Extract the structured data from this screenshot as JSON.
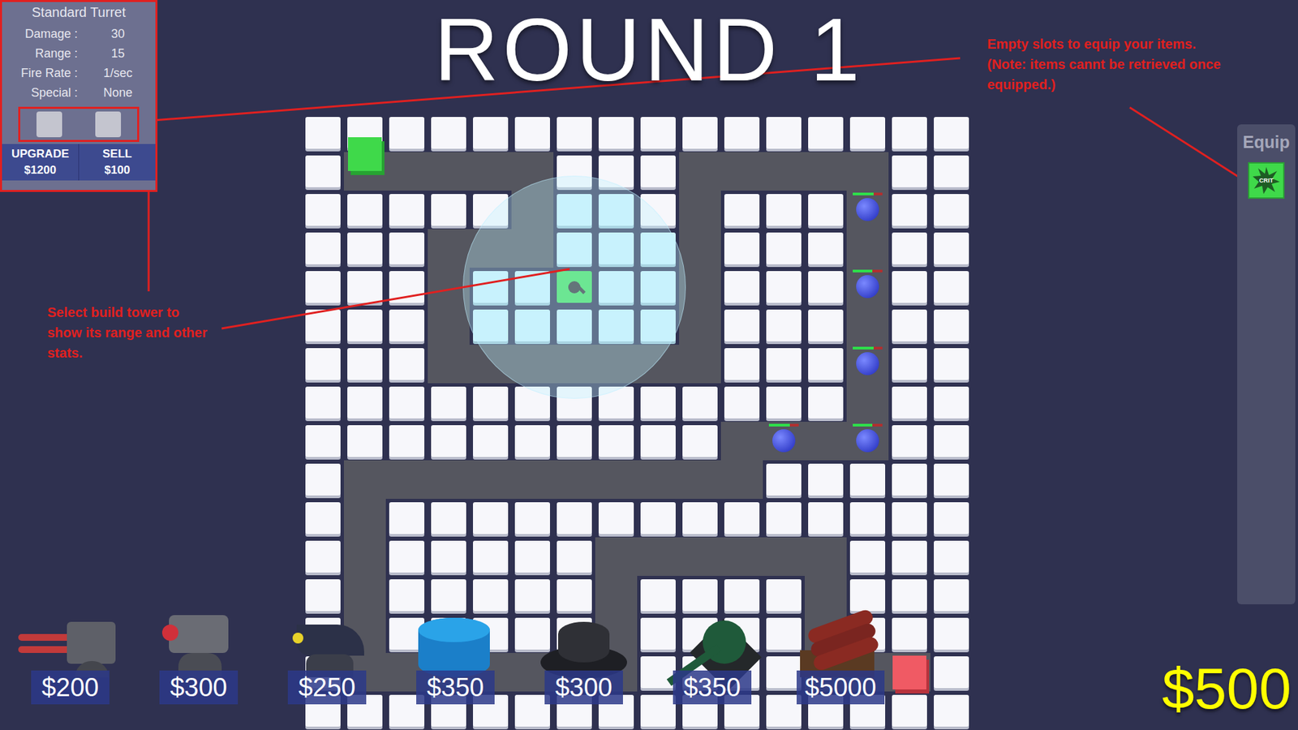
{
  "title": "ROUND 1",
  "tower_panel": {
    "name": "Standard Turret",
    "stats": [
      {
        "label": "Damage :",
        "value": "30"
      },
      {
        "label": "Range :",
        "value": "15"
      },
      {
        "label": "Fire Rate :",
        "value": "1/sec"
      },
      {
        "label": "Special :",
        "value": "None"
      }
    ],
    "slots": [
      {
        "filled": false
      },
      {
        "filled": false
      }
    ],
    "buttons": [
      {
        "label": "UPGRADE",
        "price": "$1200"
      },
      {
        "label": "SELL",
        "price": "$100"
      }
    ]
  },
  "annotations": [
    {
      "text": "Empty slots to equip your items. (Note: items cannt be retrieved once equipped.)"
    },
    {
      "text": "Select build tower to show its range and other stats."
    }
  ],
  "equip": {
    "title": "Equip",
    "items": [
      {
        "label": "CRIT"
      }
    ]
  },
  "shop": [
    {
      "kind": "double-barrel",
      "price": "$200"
    },
    {
      "kind": "laser",
      "price": "$300"
    },
    {
      "kind": "missile",
      "price": "$250"
    },
    {
      "kind": "cylinder",
      "price": "$350"
    },
    {
      "kind": "mortar",
      "price": "$300"
    },
    {
      "kind": "tank",
      "price": "$350"
    },
    {
      "kind": "dynamite",
      "price": "$5000"
    }
  ],
  "enemies": [
    {
      "level": 0.7
    },
    {
      "level": 0.65
    },
    {
      "level": 0.7
    },
    {
      "level": 0.65
    },
    {
      "level": 0.7
    }
  ],
  "money": "$500"
}
